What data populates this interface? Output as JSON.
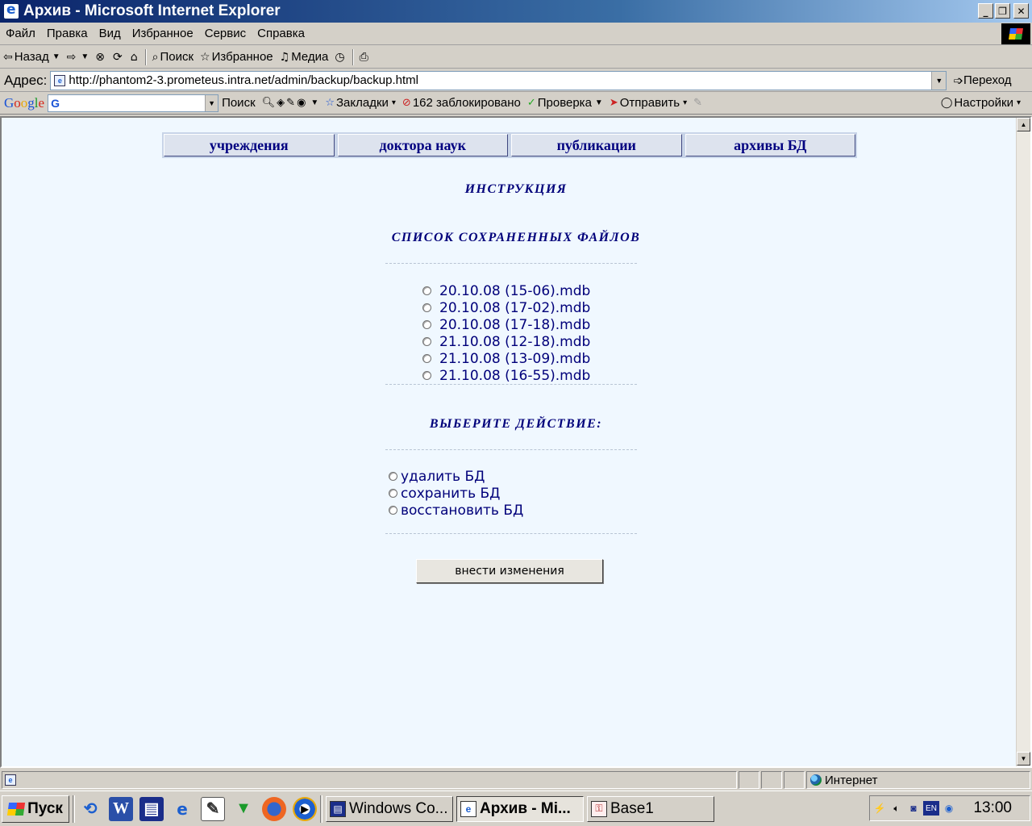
{
  "window": {
    "title": "Архив - Microsoft Internet Explorer",
    "minimize_glyph": "_",
    "maximize_glyph": "❐",
    "close_glyph": "✕"
  },
  "menu": [
    "Файл",
    "Правка",
    "Вид",
    "Избранное",
    "Сервис",
    "Справка"
  ],
  "toolbar": {
    "back_label": "Назад",
    "search_label": "Поиск",
    "favorites_label": "Избранное",
    "media_label": "Медиа"
  },
  "address": {
    "label": "Адрес:",
    "url": "http://phantom2-3.prometeus.intra.net/admin/backup/backup.html",
    "go_label": "Переход"
  },
  "google_bar": {
    "search_label": "Поиск",
    "bookmarks_label": "Закладки",
    "blocked_label": "162 заблокировано",
    "check_label": "Проверка",
    "send_label": "Отправить",
    "settings_label": "Настройки"
  },
  "page": {
    "nav": [
      "учреждения",
      "доктора наук",
      "публикации",
      "архивы БД"
    ],
    "instruction_heading": "ИНСТРУКЦИЯ",
    "files_heading": "СПИСОК СОХРАНЕННЫХ ФАЙЛОВ",
    "files": [
      "20.10.08 (15-06).mdb",
      "20.10.08 (17-02).mdb",
      "20.10.08 (17-18).mdb",
      "21.10.08 (12-18).mdb",
      "21.10.08 (13-09).mdb",
      "21.10.08 (16-55).mdb"
    ],
    "action_heading": "ВЫБЕРИТЕ ДЕЙСТВИЕ:",
    "actions": [
      "удалить БД",
      "сохранить БД",
      "восстановить БД"
    ],
    "submit_label": "внести изменения"
  },
  "status": {
    "zone": "Интернет"
  },
  "taskbar": {
    "start_label": "Пуск",
    "tasks": [
      "Windows Co...",
      "Архив - Mi...",
      "Base1"
    ],
    "clock": "13:00",
    "lang": "EN"
  }
}
